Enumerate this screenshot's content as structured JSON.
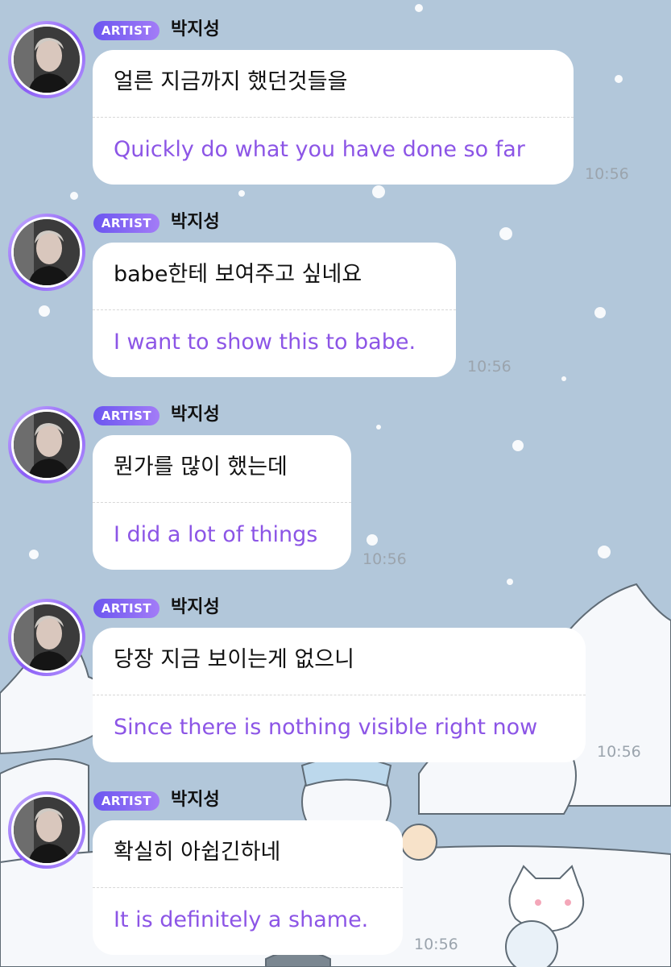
{
  "colors": {
    "background": "#b2c7da",
    "badge_gradient_start": "#6b56f0",
    "badge_gradient_end": "#a37cf7",
    "translation_text": "#8c55e6",
    "timestamp": "#9ba4ad"
  },
  "messages": [
    {
      "badge": "ARTIST",
      "sender": "박지성",
      "text": "얼른 지금까지 했던것들을",
      "translation": "Quickly do what you have done so far",
      "time": "10:56"
    },
    {
      "badge": "ARTIST",
      "sender": "박지성",
      "text": "babe한테 보여주고 싶네요",
      "translation": "I want to show this to babe.",
      "time": "10:56"
    },
    {
      "badge": "ARTIST",
      "sender": "박지성",
      "text": "뭔가를 많이 했는데",
      "translation": "I did a lot of things",
      "time": "10:56"
    },
    {
      "badge": "ARTIST",
      "sender": "박지성",
      "text": "당장 지금 보이는게 없으니",
      "translation": "Since there is nothing visible right now",
      "time": "10:56"
    },
    {
      "badge": "ARTIST",
      "sender": "박지성",
      "text": "확실히 아쉽긴하네",
      "translation": "It is definitely a shame.",
      "time": "10:56"
    }
  ]
}
